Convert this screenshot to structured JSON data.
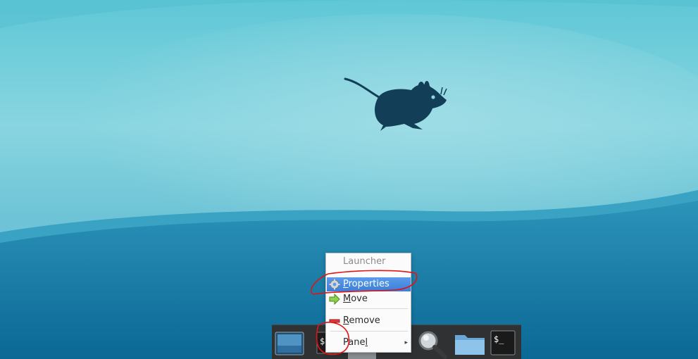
{
  "context_menu": {
    "header": "Launcher",
    "items": [
      {
        "label_pre": "",
        "label_ul": "P",
        "label_post": "roperties",
        "icon": "gear-icon",
        "highlighted": true
      },
      {
        "label_pre": "",
        "label_ul": "M",
        "label_post": "ove",
        "icon": "move-arrow-icon"
      },
      {
        "label_pre": "",
        "label_ul": "R",
        "label_post": "emove",
        "icon": "remove-icon"
      },
      {
        "label_pre": "Pane",
        "label_ul": "l",
        "label_post": "",
        "icon": "",
        "submenu": "▸"
      }
    ]
  },
  "panel": {
    "launchers": [
      {
        "name": "show-desktop"
      },
      {
        "name": "terminal-emulator",
        "glyph": "$"
      },
      {
        "name": "web-browser"
      },
      {
        "name": "app-finder"
      },
      {
        "name": "file-manager"
      },
      {
        "name": "terminal",
        "glyph": "$_"
      }
    ]
  },
  "colors": {
    "highlight": "#3b7fd9",
    "annotation": "#e01414",
    "panel_bg": "#2f3133"
  }
}
